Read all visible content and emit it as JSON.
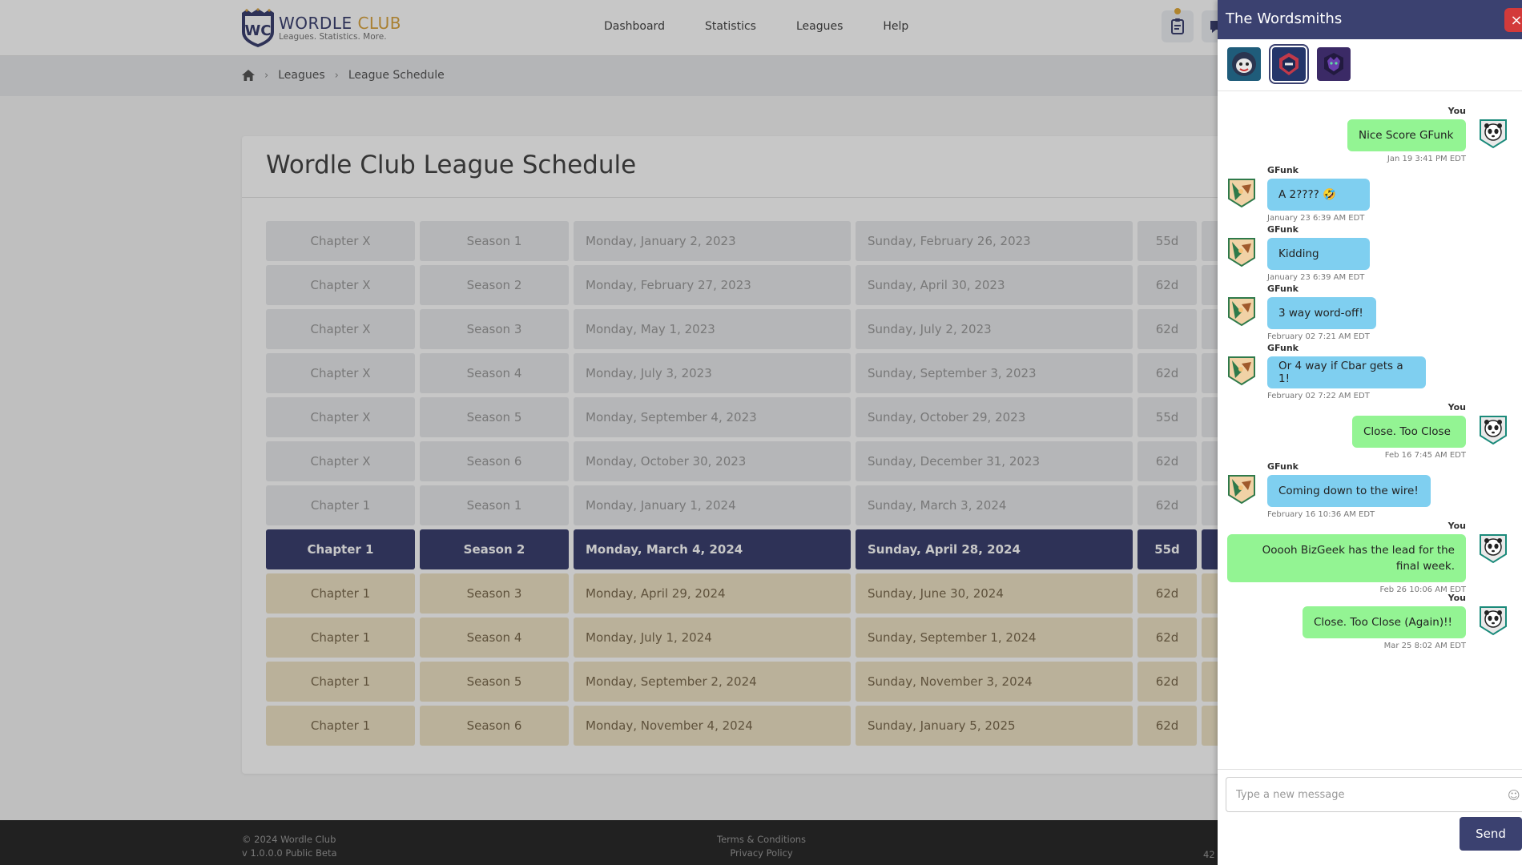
{
  "header": {
    "logo_title_a": "WORDLE",
    "logo_title_b": " CLUB",
    "logo_tagline": "Leagues. Statistics. More.",
    "nav": [
      "Dashboard",
      "Statistics",
      "Leagues",
      "Help"
    ]
  },
  "breadcrumb": {
    "items": [
      "Leagues",
      "League Schedule"
    ]
  },
  "schedule": {
    "title": "Wordle Club League Schedule",
    "rows": [
      {
        "chapter": "Chapter X",
        "season": "Season 1",
        "start": "Monday, January 2, 2023",
        "end": "Sunday, February 26, 2023",
        "duration": "55d",
        "status": "past"
      },
      {
        "chapter": "Chapter X",
        "season": "Season 2",
        "start": "Monday, February 27, 2023",
        "end": "Sunday, April 30, 2023",
        "duration": "62d",
        "status": "past"
      },
      {
        "chapter": "Chapter X",
        "season": "Season 3",
        "start": "Monday, May 1, 2023",
        "end": "Sunday, July 2, 2023",
        "duration": "62d",
        "status": "past"
      },
      {
        "chapter": "Chapter X",
        "season": "Season 4",
        "start": "Monday, July 3, 2023",
        "end": "Sunday, September 3, 2023",
        "duration": "62d",
        "status": "past"
      },
      {
        "chapter": "Chapter X",
        "season": "Season 5",
        "start": "Monday, September 4, 2023",
        "end": "Sunday, October 29, 2023",
        "duration": "55d",
        "status": "past"
      },
      {
        "chapter": "Chapter X",
        "season": "Season 6",
        "start": "Monday, October 30, 2023",
        "end": "Sunday, December 31, 2023",
        "duration": "62d",
        "status": "past"
      },
      {
        "chapter": "Chapter 1",
        "season": "Season 1",
        "start": "Monday, January 1, 2024",
        "end": "Sunday, March 3, 2024",
        "duration": "62d",
        "status": "past"
      },
      {
        "chapter": "Chapter 1",
        "season": "Season 2",
        "start": "Monday, March 4, 2024",
        "end": "Sunday, April 28, 2024",
        "duration": "55d",
        "status": "current"
      },
      {
        "chapter": "Chapter 1",
        "season": "Season 3",
        "start": "Monday, April 29, 2024",
        "end": "Sunday, June 30, 2024",
        "duration": "62d",
        "status": "future"
      },
      {
        "chapter": "Chapter 1",
        "season": "Season 4",
        "start": "Monday, July 1, 2024",
        "end": "Sunday, September 1, 2024",
        "duration": "62d",
        "status": "future"
      },
      {
        "chapter": "Chapter 1",
        "season": "Season 5",
        "start": "Monday, September 2, 2024",
        "end": "Sunday, November 3, 2024",
        "duration": "62d",
        "status": "future"
      },
      {
        "chapter": "Chapter 1",
        "season": "Season 6",
        "start": "Monday, November 4, 2024",
        "end": "Sunday, January 5, 2025",
        "duration": "62d",
        "status": "future"
      }
    ]
  },
  "footer": {
    "copyright": "© 2024 Wordle Club",
    "version": "v 1.0.0.0 Public Beta",
    "terms": "Terms & Conditions",
    "privacy": "Privacy Policy",
    "right_fragment": "42"
  },
  "chat": {
    "title": "The Wordsmiths",
    "close_label": "×",
    "input_placeholder": "Type a new message",
    "send_label": "Send",
    "messages": [
      {
        "sender": "You",
        "text": "Nice Score GFunk",
        "time": "Jan 19 3:41 PM EDT",
        "mine": true
      },
      {
        "sender": "GFunk",
        "text": "A 2???? 🤣",
        "time": "January 23 6:39 AM EDT",
        "mine": false
      },
      {
        "sender": "GFunk",
        "text": "Kidding",
        "time": "January 23 6:39 AM EDT",
        "mine": false
      },
      {
        "sender": "GFunk",
        "text": "3 way word-off!",
        "time": "February 02 7:21 AM EDT",
        "mine": false
      },
      {
        "sender": "GFunk",
        "text": "Or 4 way if Cbar gets a 1!",
        "time": "February 02 7:22 AM EDT",
        "mine": false
      },
      {
        "sender": "You",
        "text": "Close. Too Close",
        "time": "Feb 16 7:45 AM EDT",
        "mine": true
      },
      {
        "sender": "GFunk",
        "text": "Coming down to the wire!",
        "time": "February 16 10:36 AM EDT",
        "mine": false
      },
      {
        "sender": "You",
        "text": "Ooooh BizGeek has the lead for the final week.",
        "time": "Feb 26 10:06 AM EDT",
        "mine": true
      },
      {
        "sender": "You",
        "text": "Close. Too Close (Again)!!",
        "time": "Mar 25 8:02 AM EDT",
        "mine": true
      }
    ]
  },
  "colors": {
    "brand_navy": "#3b4170",
    "brand_gold": "#d9a441",
    "bubble_mine": "#93f493",
    "bubble_theirs": "#7fcff0",
    "row_future": "#efe3c6",
    "close_red": "#d33a3a"
  }
}
